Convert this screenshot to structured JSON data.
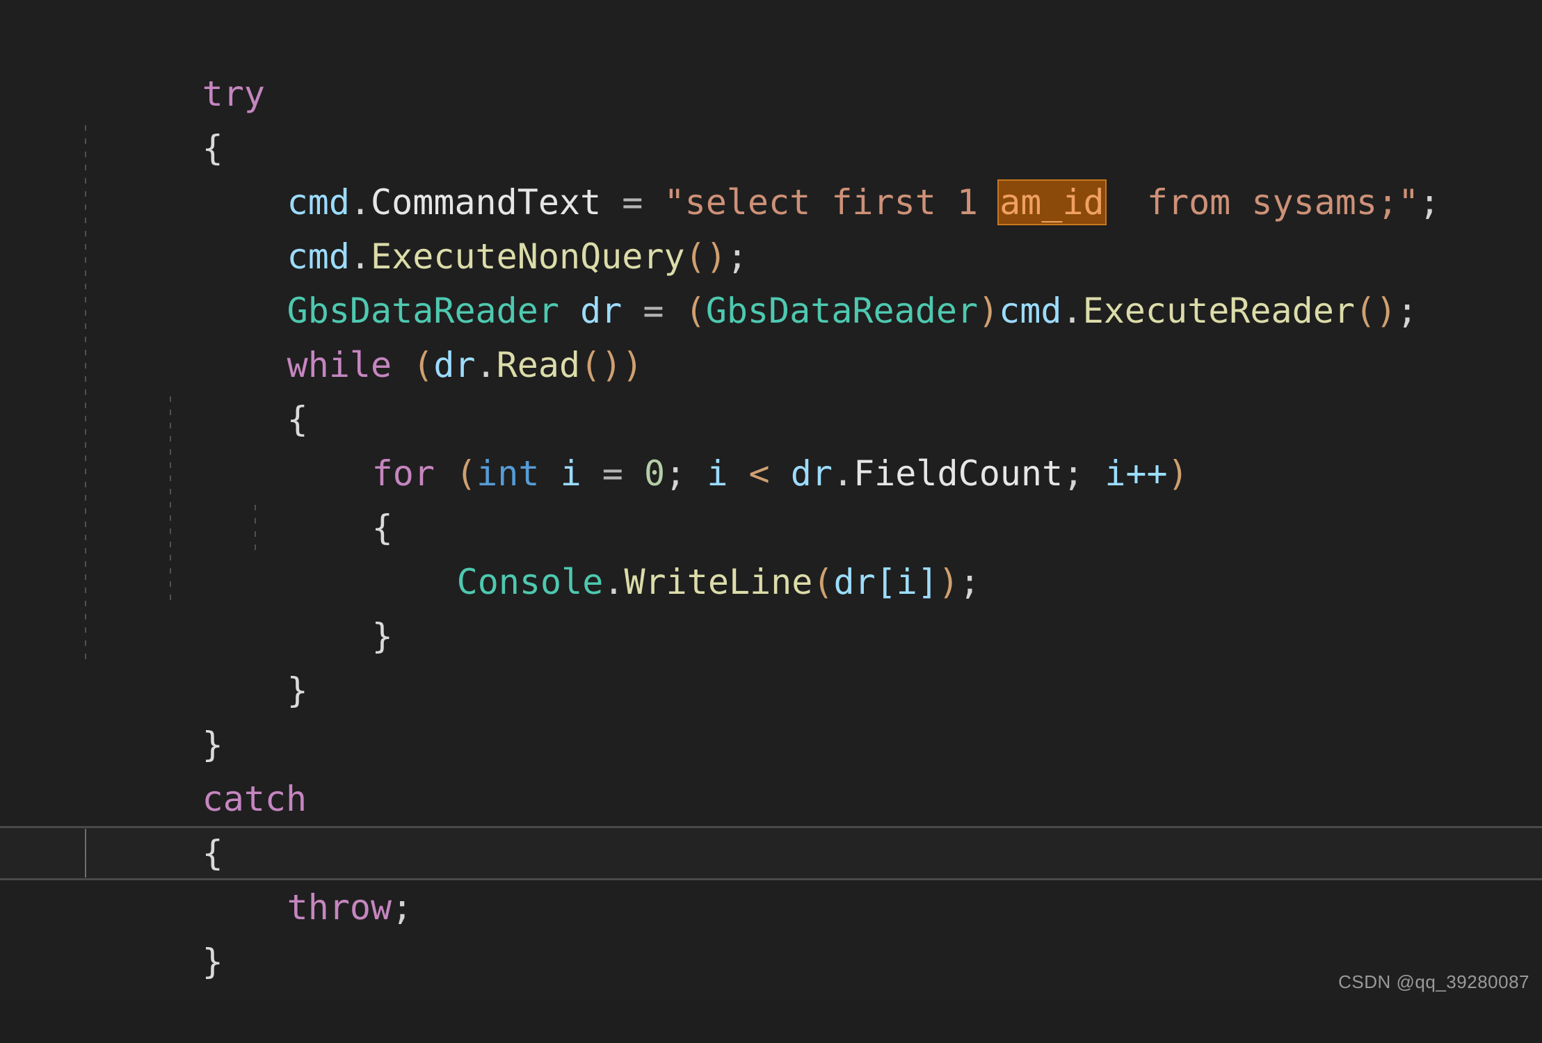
{
  "editor": {
    "background_color": "#1f1f1f",
    "default_text_color": "#d4d4d4",
    "current_line_background": "#232323",
    "current_line_border_color": "#4a4a4a",
    "search_highlight_background": "#8b4a0a",
    "search_highlight_border": "#c8781c",
    "search_highlight_text_color": "#f0a060",
    "indent_guide_color": "#6a6a6a",
    "language": "C#"
  },
  "code": {
    "full_text": "try\n{\n    cmd.CommandText = \"select first 1 am_id  from sysams;\";\n    cmd.ExecuteNonQuery();\n    GbsDataReader dr = (GbsDataReader)cmd.ExecuteReader();\n    while (dr.Read())\n    {\n        for (int i = 0; i < dr.FieldCount; i++)\n        {\n            Console.WriteLine(dr[i]);\n        }\n    }\n}\ncatch\n{\n    throw;\n}",
    "highlighted_token": "am_id",
    "current_line_text": "    throw;",
    "lines": [
      {
        "index": 1,
        "indent": 0,
        "text": "try"
      },
      {
        "index": 2,
        "indent": 0,
        "text": "{"
      },
      {
        "index": 3,
        "indent": 1,
        "text": "cmd.CommandText = \"select first 1 am_id  from sysams;\";"
      },
      {
        "index": 4,
        "indent": 1,
        "text": "cmd.ExecuteNonQuery();"
      },
      {
        "index": 5,
        "indent": 1,
        "text": "GbsDataReader dr = (GbsDataReader)cmd.ExecuteReader();"
      },
      {
        "index": 6,
        "indent": 1,
        "text": "while (dr.Read())"
      },
      {
        "index": 7,
        "indent": 1,
        "text": "{"
      },
      {
        "index": 8,
        "indent": 2,
        "text": "for (int i = 0; i < dr.FieldCount; i++)"
      },
      {
        "index": 9,
        "indent": 2,
        "text": "{"
      },
      {
        "index": 10,
        "indent": 3,
        "text": "Console.WriteLine(dr[i]);"
      },
      {
        "index": 11,
        "indent": 2,
        "text": "}"
      },
      {
        "index": 12,
        "indent": 1,
        "text": "}"
      },
      {
        "index": 13,
        "indent": 0,
        "text": "}"
      },
      {
        "index": 14,
        "indent": 0,
        "text": "catch"
      },
      {
        "index": 15,
        "indent": 0,
        "text": "{"
      },
      {
        "index": 16,
        "indent": 1,
        "text": "throw;"
      },
      {
        "index": 17,
        "indent": 0,
        "text": "}"
      }
    ],
    "tokens": {
      "kw_try": "try",
      "kw_catch": "catch",
      "kw_while": "while",
      "kw_for": "for",
      "kw_throw": "throw",
      "kw_int": "int",
      "brace_open": "{",
      "brace_close": "}",
      "obj_cmd": "cmd",
      "prop_commandtext": "CommandText",
      "op_assign": "=",
      "sql_string": "\"select first 1 am_id  from sysams;\"",
      "sql_before_hit": "\"select first 1 ",
      "sql_hit": "am_id",
      "sql_after_hit": "  from sysams;\"",
      "method_executenonquery": "ExecuteNonQuery",
      "type_gbsdatareader": "GbsDataReader",
      "local_dr": "dr",
      "cast_gbsdatareader": "(GbsDataReader)",
      "method_executereader": "ExecuteReader",
      "method_read": "Read",
      "local_i": "i",
      "number_zero": "0",
      "op_less": "<",
      "prop_fieldcount": "FieldCount",
      "op_increment": "i++",
      "class_console": "Console",
      "method_writeline": "WriteLine",
      "indexer_dri": "dr[i]",
      "semicolon": ";",
      "paren_open": "(",
      "paren_close": ")",
      "paren_empty": "()"
    }
  },
  "watermark": {
    "text": "CSDN @qq_39280087"
  }
}
